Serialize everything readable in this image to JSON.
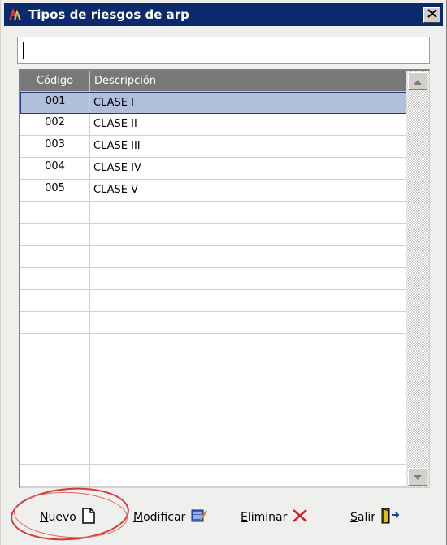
{
  "window": {
    "title": "Tipos de riesgos de arp",
    "close_symbol": "✕"
  },
  "search": {
    "value": "",
    "placeholder": ""
  },
  "grid": {
    "headers": {
      "code": "Código",
      "description": "Descripción"
    },
    "rows": [
      {
        "code": "001",
        "description": "CLASE I",
        "selected": true
      },
      {
        "code": "002",
        "description": "CLASE II"
      },
      {
        "code": "003",
        "description": "CLASE III"
      },
      {
        "code": "004",
        "description": "CLASE IV"
      },
      {
        "code": "005",
        "description": "CLASE V"
      }
    ],
    "empty_rows": 13
  },
  "toolbar": {
    "new_label_first": "N",
    "new_label_rest": "uevo",
    "modify_label_first": "M",
    "modify_label_rest": "odificar",
    "delete_label_first": "E",
    "delete_label_rest": "liminar",
    "exit_label_first": "S",
    "exit_label_rest": "alir"
  },
  "icons": {
    "app": "app-logo-icon",
    "close": "close-icon",
    "new": "new-document-icon",
    "modify": "edit-list-icon",
    "delete": "delete-x-icon",
    "exit": "exit-door-icon"
  },
  "colors": {
    "titlebar": "#0b2a6b",
    "header": "#787878",
    "selection": "#b0bfdb",
    "highlight": "#d23a3a"
  }
}
